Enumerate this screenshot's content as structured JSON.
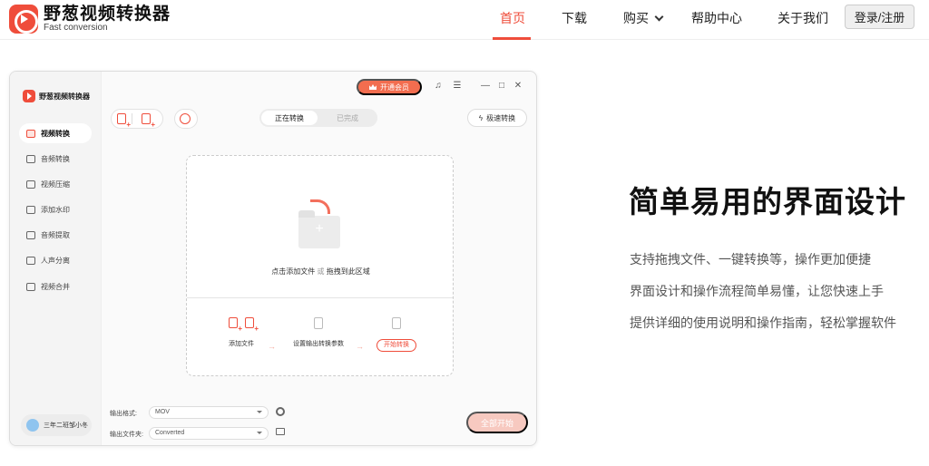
{
  "site": {
    "logo_title": "野葱视频转换器",
    "logo_sub": "Fast conversion",
    "nav": [
      "首页",
      "下载",
      "购买",
      "帮助中心",
      "关于我们"
    ],
    "active_nav": "首页",
    "login": "登录/注册",
    "accent": "#ef4d3b"
  },
  "app": {
    "title": "野葱视频转换器",
    "vip": "开通会员",
    "window_controls": [
      "headset-icon",
      "menu-icon",
      "minimize-icon",
      "maximize-icon",
      "close-icon"
    ],
    "sidebar": [
      {
        "label": "视频转换",
        "active": true
      },
      {
        "label": "音频转换"
      },
      {
        "label": "视频压缩"
      },
      {
        "label": "添加水印"
      },
      {
        "label": "音频提取"
      },
      {
        "label": "人声分离"
      },
      {
        "label": "视频合并"
      }
    ],
    "user": "三年二班邹小冬",
    "tabs": {
      "active": "正在转换",
      "inactive": "已完成"
    },
    "speed": "极速转换",
    "drop": {
      "main": "点击添加文件",
      "or": "或",
      "drag": "拖拽到此区域"
    },
    "steps": [
      "添加文件",
      "设置输出转换参数",
      "开始转换"
    ],
    "output": {
      "format_label": "输出格式:",
      "format_value": "MOV",
      "folder_label": "输出文件夹:",
      "folder_value": "Converted"
    },
    "start_all": "全部开始"
  },
  "marketing": {
    "headline": "简单易用的界面设计",
    "lines": [
      "支持拖拽文件、一键转换等，操作更加便捷",
      "界面设计和操作流程简单易懂，让您快速上手",
      "提供详细的使用说明和操作指南，轻松掌握软件"
    ]
  }
}
